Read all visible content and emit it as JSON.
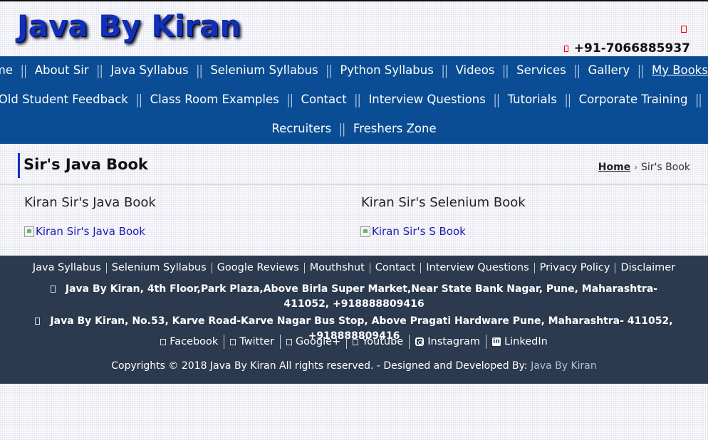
{
  "header": {
    "logo": "Java By Kiran",
    "phone": "+91-7066885937"
  },
  "nav": {
    "rows": [
      [
        "Home",
        "About Sir",
        "Java Syllabus",
        "Selenium Syllabus",
        "Python Syllabus",
        "Videos",
        "Services",
        "Gallery",
        "My Books"
      ],
      [
        "Old Student Feedback",
        "Class Room Examples",
        "Contact",
        "Interview Questions",
        "Tutorials",
        "Corporate Training"
      ],
      [
        "Recruiters",
        "Freshers Zone"
      ]
    ],
    "active": "My Books",
    "separator": "||"
  },
  "page": {
    "title": "Sir's Java Book",
    "breadcrumb": {
      "home": "Home",
      "separator": "›",
      "current": "Sir's Book"
    }
  },
  "books": [
    {
      "heading": "Kiran Sir's Java Book",
      "image_alt": "Kiran Sir's Java Book"
    },
    {
      "heading": "Kiran Sir's Selenium Book",
      "image_alt": "Kiran Sir's S Book"
    }
  ],
  "footer": {
    "links": [
      "Java Syllabus",
      "Selenium Syllabus",
      "Google Reviews",
      "Mouthshut",
      "Contact",
      "Interview Questions",
      "Privacy Policy",
      "Disclaimer"
    ],
    "address1": "Java By Kiran, 4th Floor,Park Plaza,Above Birla Super Market,Near State Bank Nagar, Pune, Maharashtra- 411052, +918888809416",
    "address2": "Java By Kiran, No.53, Karve Road-Karve Nagar Bus Stop, Above Pragati Hardware Pune, Maharashtra- 411052, +918888809416",
    "social": [
      {
        "label": "Facebook",
        "icon": "facebook-icon"
      },
      {
        "label": "Twitter",
        "icon": "twitter-icon"
      },
      {
        "label": "Google+",
        "icon": "google-plus-icon"
      },
      {
        "label": "Youtube",
        "icon": "youtube-icon"
      },
      {
        "label": "Instagram",
        "icon": "instagram-icon"
      },
      {
        "label": "LinkedIn",
        "icon": "linkedin-icon"
      }
    ],
    "copyright": "Copyrights © 2018 Java By Kiran All rights reserved. - Designed and Developed By:",
    "credit": "Java By Kiran"
  },
  "colors": {
    "logo": "#1030b8",
    "navbar": "#0a4d94",
    "footer": "#2b3a4e",
    "title_accent": "#1432c4"
  }
}
